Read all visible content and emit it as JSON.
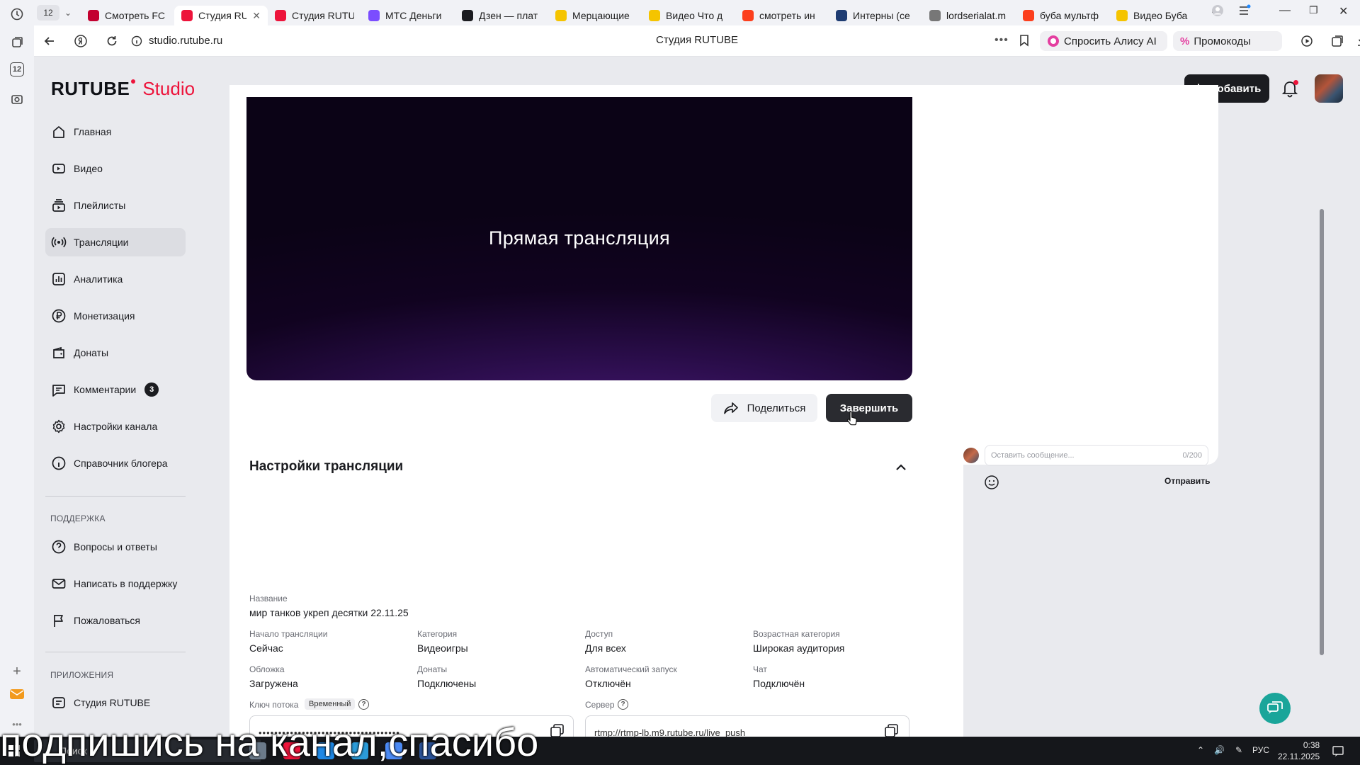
{
  "browser": {
    "tab_count": "12",
    "left_badge": "12",
    "tabs": [
      {
        "title": "Смотреть FC",
        "color": "#c3002f"
      },
      {
        "title": "Студия RU",
        "color": "#ed143b",
        "active": true
      },
      {
        "title": "Студия RUTU",
        "color": "#ed143b"
      },
      {
        "title": "МТС Деньги",
        "color": "#7b4dff"
      },
      {
        "title": "Дзен — плат",
        "color": "#1b1c20"
      },
      {
        "title": "Мерцающие",
        "color": "#f5c400"
      },
      {
        "title": "Видео Что д",
        "color": "#f5c400"
      },
      {
        "title": "смотреть ин",
        "color": "#fc3f1d"
      },
      {
        "title": "Интерны (се",
        "color": "#1e3c72"
      },
      {
        "title": "lordserialat.m",
        "color": "#777777"
      },
      {
        "title": "буба мультф",
        "color": "#fc3f1d"
      },
      {
        "title": "Видео Буба",
        "color": "#f5c400"
      }
    ],
    "url": "studio.rutube.ru",
    "page_title": "Студия RUTUBE",
    "alice_label": "Спросить Алису AI",
    "promo_label": "Промокоды"
  },
  "header": {
    "logo_main": "RUTUBE",
    "logo_sub": "Studio",
    "add_label": "Добавить"
  },
  "sidebar": {
    "items": [
      {
        "label": "Главная",
        "icon": "home-icon"
      },
      {
        "label": "Видео",
        "icon": "video-icon"
      },
      {
        "label": "Плейлисты",
        "icon": "playlist-icon"
      },
      {
        "label": "Трансляции",
        "icon": "broadcast-icon",
        "active": true
      },
      {
        "label": "Аналитика",
        "icon": "analytics-icon"
      },
      {
        "label": "Монетизация",
        "icon": "ruble-icon"
      },
      {
        "label": "Донаты",
        "icon": "wallet-icon"
      },
      {
        "label": "Комментарии",
        "icon": "comment-icon",
        "badge": "3"
      },
      {
        "label": "Настройки канала",
        "icon": "gear-icon"
      },
      {
        "label": "Справочник блогера",
        "icon": "info-icon"
      }
    ],
    "support_caption": "ПОДДЕРЖКА",
    "support_items": [
      {
        "label": "Вопросы и ответы",
        "icon": "question-icon"
      },
      {
        "label": "Написать в поддержку",
        "icon": "mail-icon"
      },
      {
        "label": "Пожаловаться",
        "icon": "flag-icon"
      }
    ],
    "apps_caption": "ПРИЛОЖЕНИЯ",
    "apps_items": [
      {
        "label": "Студия RUTUBE",
        "icon": "studio-icon"
      }
    ]
  },
  "player": {
    "overlay_text": "Прямая трансляция",
    "share_label": "Поделиться",
    "finish_label": "Завершить"
  },
  "settings": {
    "title": "Настройки трансляции",
    "name_label": "Название",
    "name_value": "мир танков укреп десятки 22.11.25",
    "fields": [
      {
        "label": "Начало трансляции",
        "value": "Сейчас"
      },
      {
        "label": "Категория",
        "value": "Видеоигры"
      },
      {
        "label": "Доступ",
        "value": "Для всех"
      },
      {
        "label": "Возрастная категория",
        "value": "Широкая аудитория"
      },
      {
        "label": "Обложка",
        "value": "Загружена"
      },
      {
        "label": "Донаты",
        "value": "Подключены"
      },
      {
        "label": "Автоматический запуск",
        "value": "Отключён"
      },
      {
        "label": "Чат",
        "value": "Подключён"
      }
    ],
    "stream_key_label": "Ключ потока",
    "stream_key_tag": "Временный",
    "stream_key_value": "••••••••••••••••••••••••••••••••••••",
    "server_label": "Сервер",
    "server_value": "rtmp://rtmp-lb.m9.rutube.ru/live_push"
  },
  "chat": {
    "placeholder": "Оставить сообщение...",
    "counter": "0/200",
    "send_label": "Отправить"
  },
  "taskbar": {
    "search_label": "Поиск",
    "lang": "РУС",
    "time": "0:38",
    "date": "22.11.2025"
  },
  "subtitle": "подпишись на канал,спасибо"
}
